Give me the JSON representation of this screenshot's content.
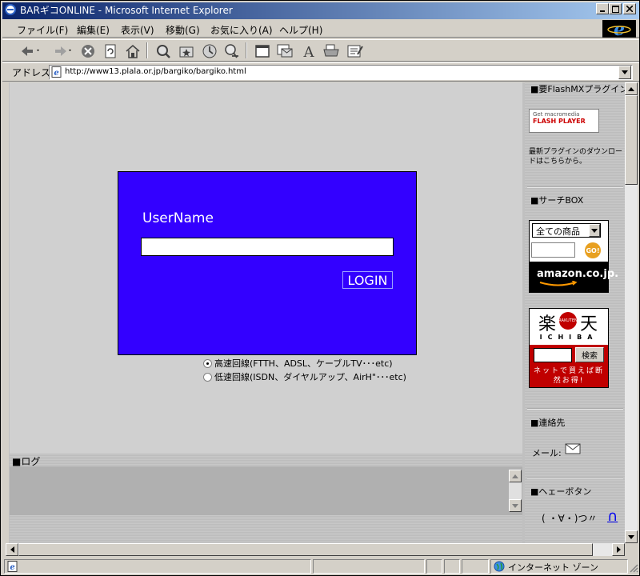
{
  "window": {
    "title": "BARギコONLINE - Microsoft Internet Explorer",
    "controls": [
      "_",
      "□",
      "×"
    ]
  },
  "menu": [
    "ファイル(F)",
    "編集(E)",
    "表示(V)",
    "移動(G)",
    "お気に入り(A)",
    "ヘルプ(H)"
  ],
  "toolbar_icons": [
    "back-icon",
    "forward-icon",
    "stop-icon",
    "refresh-icon",
    "home-icon",
    "search-icon",
    "favorites-icon",
    "history-icon",
    "channels-icon",
    "fullscreen-icon",
    "mail-icon",
    "font-icon",
    "print-icon",
    "edit-icon"
  ],
  "address": {
    "label": "アドレス",
    "url": "http://www13.plala.or.jp/bargiko/bargiko.html"
  },
  "login": {
    "username_label": "UserName",
    "username_value": "",
    "login_button": "LOGIN",
    "options": [
      {
        "label": "高速回線(FTTH、ADSL、ケーブルTV･･･etc)",
        "selected": true
      },
      {
        "label": "低速回線(ISDN、ダイヤルアップ、AirH\"･･･etc)",
        "selected": false
      }
    ]
  },
  "log": {
    "heading": "■ログ"
  },
  "sidebar": {
    "flash_heading": "■要FlashMXプラグイン",
    "flash_button_line1": "Get macromedia",
    "flash_button_line2": "FLASH PLAYER",
    "flash_text": "最新プラグインのダウンロードはこちらから。",
    "search_heading": "■サーチBOX",
    "amazon_select": "全ての商品",
    "amazon_go": "GO!",
    "amazon_logo": "amazon.co.jp.",
    "rakuten_kanji_1": "楽",
    "rakuten_badge": "RAKUTEN",
    "rakuten_kanji_2": "天",
    "rakuten_ichiba": "ICHIBA",
    "rakuten_button": "検索",
    "rakuten_slogan": "ネットで買えば断然お得!",
    "contact_heading": "■連絡先",
    "mail_label": "メール:",
    "he_heading": "■ヘェーボタン",
    "he_text": "( ・∀・)つ〃",
    "he_button": "∩"
  },
  "status": {
    "zone": "インターネット ゾーン"
  },
  "colors": {
    "login_bg": "#3300ff",
    "titlebar_start": "#0a246a",
    "titlebar_end": "#a6caf0"
  }
}
